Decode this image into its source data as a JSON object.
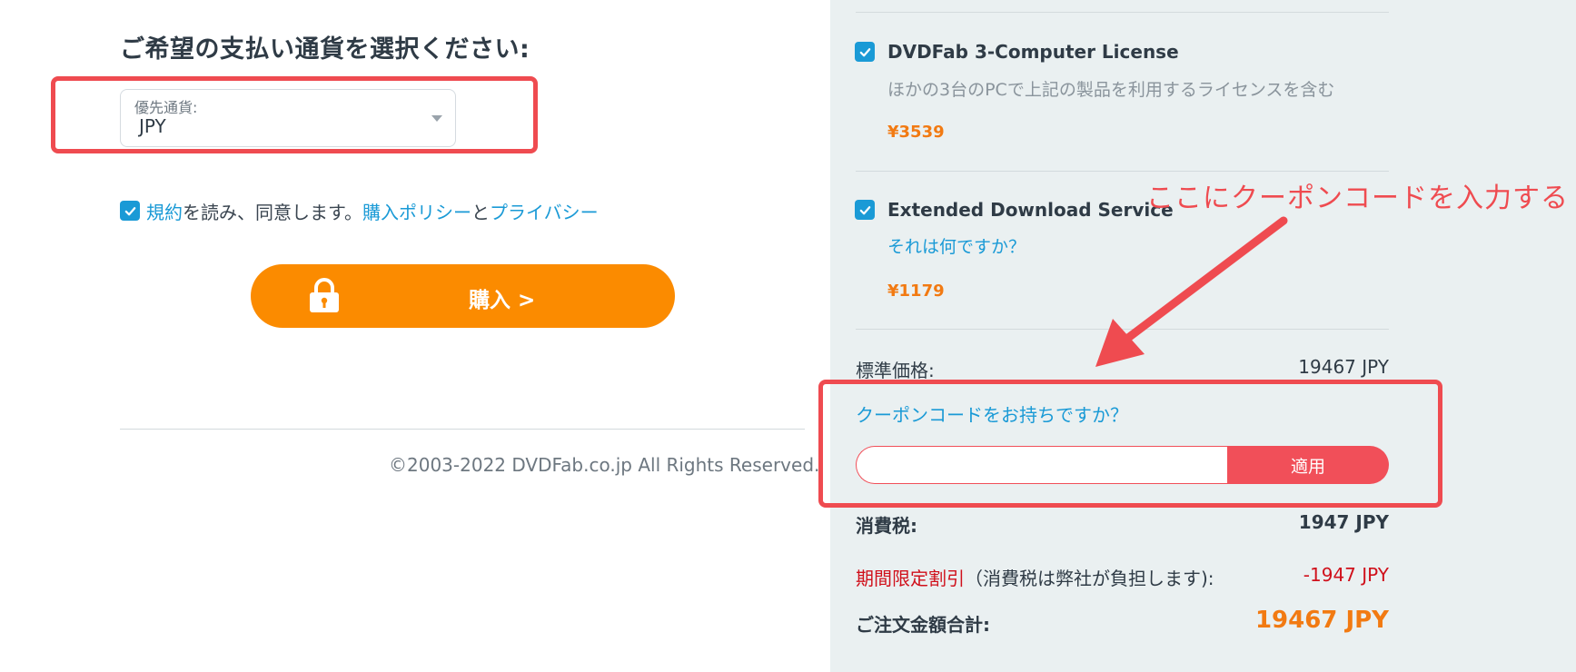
{
  "left": {
    "heading": "ご希望の支払い通貨を選択ください:",
    "currency": {
      "label": "優先通貨:",
      "value": "JPY"
    },
    "agreement": {
      "checked": true,
      "terms_link": "規約",
      "text1": "を読み、同意します。",
      "policy_link": "購入ポリシー",
      "text2": "と",
      "privacy_link": "プライバシー"
    },
    "buy_button": {
      "label": "購入 >",
      "icon": "lock-icon"
    },
    "copyright": "©2003-2022 DVDFab.co.jp All Rights Reserved."
  },
  "right": {
    "items": [
      {
        "checked": true,
        "title": "DVDFab 3-Computer License",
        "description": "ほかの3台のPCで上記の製品を利用するライセンスを含む",
        "price": "¥3539"
      },
      {
        "checked": true,
        "title": "Extended Download Service",
        "link": "それは何ですか？",
        "price": "¥1179"
      }
    ],
    "standard_price": {
      "label": "標準価格:",
      "value": "19467 JPY"
    },
    "coupon": {
      "question": "クーポンコードをお持ちですか？",
      "input_value": "",
      "apply_label": "適用"
    },
    "tax": {
      "label": "消費税:",
      "value": "1947 JPY"
    },
    "discount": {
      "label": "期間限定割引",
      "note": "（消費税は弊社が負担します):",
      "value": "-1947 JPY"
    },
    "total": {
      "label": "ご注文金額合計:",
      "value": "19467 JPY"
    }
  },
  "annotation": {
    "text": "ここにクーポンコードを入力する"
  },
  "colors": {
    "accent_blue": "#1a9ad6",
    "buy_orange": "#fb8b00",
    "price_orange": "#f27a12",
    "coupon_red": "#f14f59",
    "annotation_red": "#ef4b50",
    "discount_red": "#d0101b",
    "panel_bg": "#eaf0f1"
  }
}
